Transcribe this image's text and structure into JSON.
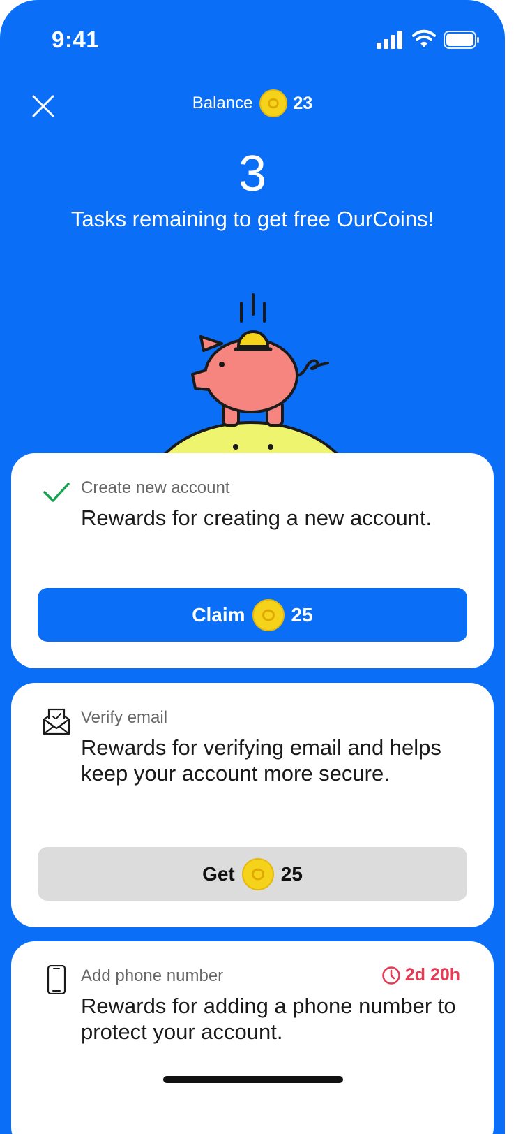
{
  "status_bar": {
    "time": "9:41"
  },
  "header": {
    "balance_label": "Balance",
    "balance_value": "23",
    "tasks_remaining": "3",
    "subtitle": "Tasks remaining to get free OurCoins!"
  },
  "tasks": [
    {
      "title": "Create new account",
      "description": "Rewards for creating a new account.",
      "button_label": "Claim",
      "reward": "25",
      "status": "completed",
      "icon": "checkmark-icon"
    },
    {
      "title": "Verify email",
      "description": "Rewards for verifying email and helps keep your account more secure.",
      "button_label": "Get",
      "reward": "25",
      "status": "pending",
      "icon": "email-icon"
    },
    {
      "title": "Add phone number",
      "description": "Rewards for adding a phone number to protect your account.",
      "timer": "2d 20h",
      "status": "pending",
      "icon": "phone-icon"
    }
  ],
  "colors": {
    "primary": "#0a6ef7",
    "coin": "#f6d31b",
    "success": "#1aa252",
    "timer": "#e63a55",
    "disabled_button": "#dcdcdc"
  }
}
